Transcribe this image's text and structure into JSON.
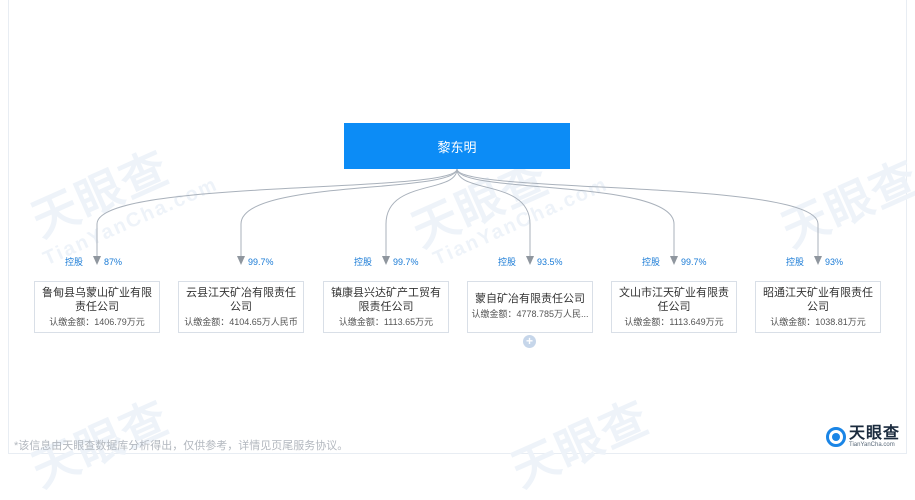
{
  "root": {
    "name": "黎东明"
  },
  "companies": [
    {
      "name": "鲁甸县乌蒙山矿业有限责任公司",
      "capital": "认缴金额：1406.79万元",
      "percent": "87%",
      "tag": "控股"
    },
    {
      "name": "云县江天矿冶有限责任公司",
      "capital": "认缴金额：4104.65万人民币",
      "percent": "99.7%",
      "tag": ""
    },
    {
      "name": "镇康县兴达矿产工贸有限责任公司",
      "capital": "认缴金额：1113.65万元",
      "percent": "99.7%",
      "tag": "控股"
    },
    {
      "name": "蒙自矿冶有限责任公司",
      "capital": "认缴金额：4778.785万人民...",
      "percent": "93.5%",
      "tag": "控股"
    },
    {
      "name": "文山市江天矿业有限责任公司",
      "capital": "认缴金额：1113.649万元",
      "percent": "99.7%",
      "tag": "控股"
    },
    {
      "name": "昭通江天矿业有限责任公司",
      "capital": "认缴金额：1038.81万元",
      "percent": "93%",
      "tag": "控股"
    }
  ],
  "watermark": {
    "cn": "天眼查",
    "en": "TianYanCha.com"
  },
  "footnote": "*该信息由天眼查数据库分析得出，仅供参考，详情见页尾服务协议。",
  "logo": {
    "cn": "天眼查",
    "en": "TianYanCha.com"
  },
  "expand": {
    "icon": "plus-icon"
  }
}
